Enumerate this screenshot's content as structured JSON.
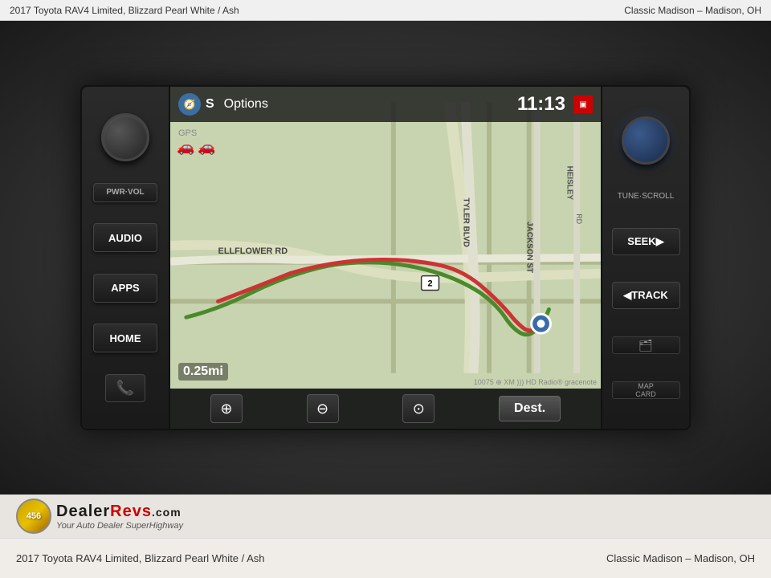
{
  "topbar": {
    "car_title": "2017 Toyota RAV4 Limited,",
    "color": "Blizzard Pearl White / Ash",
    "separator": "  ",
    "dealer": "Classic Madison – Madison, OH"
  },
  "screen": {
    "nav_letter": "S",
    "options_label": "Options",
    "time": "11:13",
    "gps_label": "GPS",
    "distance": "0.25mi",
    "dest_button": "Dest.",
    "road_label1": "ELLFLOWER RD",
    "road_label2": "TYLER BLVD",
    "road_label3": "JACKSON ST",
    "road_label4": "HEISLEY",
    "road_num": "2",
    "bottom_info": "10075  ⊕ XM ))) HD Radio®  gracenote"
  },
  "left_controls": {
    "pwr_vol": "PWR·VOL",
    "audio": "AUDIO",
    "apps": "APPS",
    "home": "HOME"
  },
  "right_controls": {
    "tune_scroll": "TUNE·SCROLL",
    "seek": "SEEK▶",
    "track": "◀TRACK",
    "map_card": "MAP\nCARD"
  },
  "footer": {
    "logo_nums": "456",
    "logo_dealer": "Dealer",
    "logo_revs": "Revs",
    "logo_com": ".com",
    "logo_tagline": "Your Auto Dealer SuperHighway",
    "car_title": "2017 Toyota RAV4 Limited,",
    "color": "Blizzard Pearl White / Ash",
    "dealer": "Classic Madison – Madison, OH"
  }
}
